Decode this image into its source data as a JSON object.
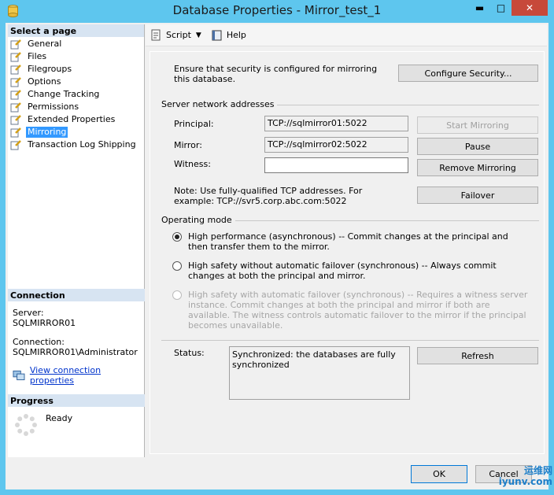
{
  "window": {
    "title": "Database Properties - Mirror_test_1"
  },
  "left": {
    "select_header": "Select a page",
    "pages": [
      {
        "label": "General"
      },
      {
        "label": "Files"
      },
      {
        "label": "Filegroups"
      },
      {
        "label": "Options"
      },
      {
        "label": "Change Tracking"
      },
      {
        "label": "Permissions"
      },
      {
        "label": "Extended Properties"
      },
      {
        "label": "Mirroring",
        "selected": true
      },
      {
        "label": "Transaction Log Shipping"
      }
    ],
    "connection_header": "Connection",
    "server_label": "Server:",
    "server_value": "SQLMIRROR01",
    "connection_label": "Connection:",
    "connection_value": "SQLMIRROR01\\Administrator",
    "view_link": "View connection properties",
    "progress_header": "Progress",
    "progress_status": "Ready"
  },
  "toolbar": {
    "script": "Script",
    "help": "Help"
  },
  "security": {
    "text": "Ensure that security is configured for mirroring this database.",
    "configure_button": "Configure Security..."
  },
  "network": {
    "group_label": "Server network addresses",
    "principal_label": "Principal:",
    "principal_value": "TCP://sqlmirror01:5022",
    "mirror_label": "Mirror:",
    "mirror_value": "TCP://sqlmirror02:5022",
    "witness_label": "Witness:",
    "witness_value": "",
    "start_button": "Start Mirroring",
    "pause_button": "Pause",
    "remove_button": "Remove Mirroring",
    "failover_button": "Failover",
    "note": "Note: Use fully-qualified TCP addresses. For example: TCP://svr5.corp.abc.com:5022"
  },
  "mode": {
    "group_label": "Operating mode",
    "options": [
      {
        "text": "High performance (asynchronous) -- Commit changes at the principal and then transfer them to the mirror.",
        "checked": true,
        "disabled": false
      },
      {
        "text": "High safety without automatic failover (synchronous) -- Always commit changes at both the principal and mirror.",
        "checked": false,
        "disabled": false
      },
      {
        "text": "High safety with automatic failover (synchronous) -- Requires a witness server instance. Commit changes at both the principal and mirror if both are available. The witness controls automatic failover to the mirror if the principal becomes unavailable.",
        "checked": false,
        "disabled": true
      }
    ]
  },
  "status": {
    "label": "Status:",
    "value": "Synchronized: the databases are fully synchronized",
    "refresh_button": "Refresh"
  },
  "footer": {
    "ok_button": "OK",
    "cancel_button": "Cancel"
  },
  "watermark": {
    "line1": "运维网",
    "line2": "iyunv.com"
  }
}
